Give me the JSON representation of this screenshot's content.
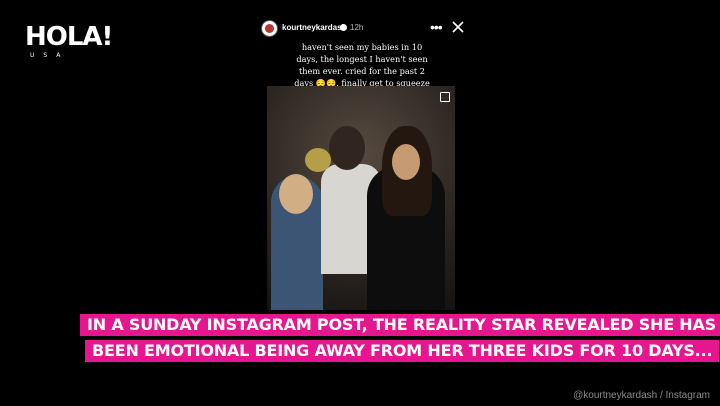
{
  "brand": {
    "name": "HOLA!",
    "sub": "USA"
  },
  "story": {
    "username": "kourtneykardash",
    "time": "12h",
    "more_icon": "more-horizontal-icon",
    "close_icon": "close-icon",
    "caption": "haven't seen my babies in 10 days, the longest I haven't seen them ever. cried for the past 2 days 😔😔. finally get to squeeze them tomorrow!"
  },
  "subtitles": [
    "IN A SUNDAY INSTAGRAM POST, THE REALITY STAR REVEALED SHE HAS",
    "BEEN EMOTIONAL BEING AWAY FROM HER THREE KIDS FOR 10 DAYS..."
  ],
  "credit": "@kourtneykardash / Instagram",
  "colors": {
    "subtitle_bg": "#e6168e",
    "background": "#000000"
  }
}
